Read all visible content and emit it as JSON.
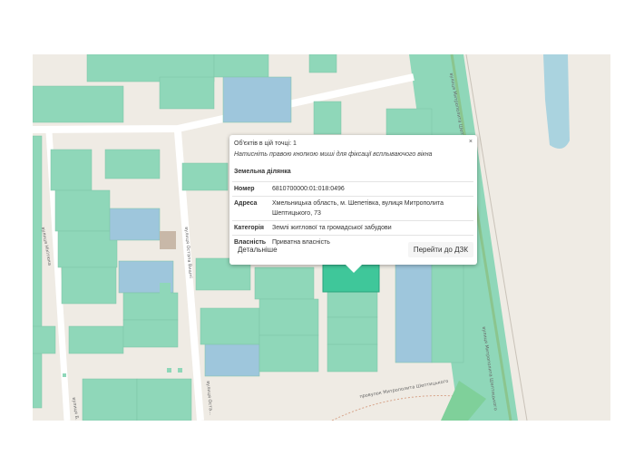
{
  "map": {
    "colors": {
      "background": "#efebe4",
      "parcel": "#8fd7b9",
      "parcel_selected": "#3fc79a",
      "parcel_blue": "#9ec6dc",
      "road": "#ffffff",
      "railway_strip": "#7fd09a",
      "water": "#aad3df"
    },
    "road_labels": [
      "вулиця Нікітюка",
      "вулиця Остапа Вишні",
      "вулиця Митрополита Шептицького",
      "вулиця Митрополита Шептицького",
      "провулок Митрополита Шептицького",
      "вулиця Б...",
      "вулиця Оста..."
    ]
  },
  "popup": {
    "count_text": "Об'єктів в цій точці: 1",
    "hint_text": "Натисніть правою кнопкою миші для фіксації всплываючого вікна",
    "close_label": "×",
    "section_title": "Земельна ділянка",
    "rows": [
      {
        "key": "Номер",
        "value": "6810700000:01:018:0496"
      },
      {
        "key": "Адреса",
        "value": "Хмельницька область, м. Шепетівка, вулиця Митрополита Шептицького, 73"
      },
      {
        "key": "Категорія",
        "value": "Землі житлової та громадської забудови"
      },
      {
        "key": "Власність",
        "value": "Приватна власність"
      }
    ],
    "details_button": "Детальніше",
    "dzk_button": "Перейти до ДЗК"
  }
}
